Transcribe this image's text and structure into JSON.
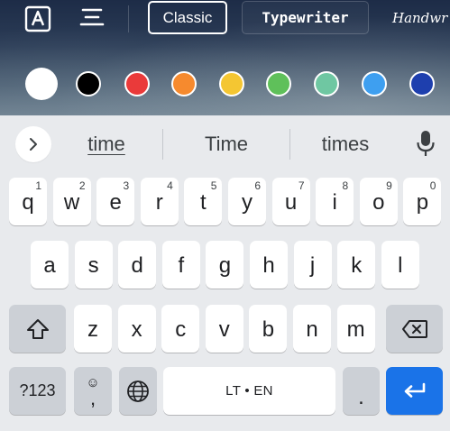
{
  "editor": {
    "fonts": [
      {
        "label": "Classic",
        "selected": true
      },
      {
        "label": "Typewriter",
        "selected": false
      },
      {
        "label": "Handwr",
        "selected": false
      }
    ],
    "icons": {
      "text_style": "text-box-icon",
      "align": "align-center-icon"
    },
    "colors": [
      {
        "hex": "#ffffff",
        "selected": true
      },
      {
        "hex": "#000000",
        "selected": false
      },
      {
        "hex": "#ea3a3a",
        "selected": false
      },
      {
        "hex": "#f68a2e",
        "selected": false
      },
      {
        "hex": "#f4c632",
        "selected": false
      },
      {
        "hex": "#5fc05a",
        "selected": false
      },
      {
        "hex": "#6fc7a2",
        "selected": false
      },
      {
        "hex": "#3e9ff0",
        "selected": false
      },
      {
        "hex": "#1e3fae",
        "selected": false
      }
    ]
  },
  "keyboard": {
    "suggestions": [
      "time",
      "Time",
      "times"
    ],
    "row1": [
      {
        "letter": "q",
        "hint": "1"
      },
      {
        "letter": "w",
        "hint": "2"
      },
      {
        "letter": "e",
        "hint": "3"
      },
      {
        "letter": "r",
        "hint": "4"
      },
      {
        "letter": "t",
        "hint": "5"
      },
      {
        "letter": "y",
        "hint": "6"
      },
      {
        "letter": "u",
        "hint": "7"
      },
      {
        "letter": "i",
        "hint": "8"
      },
      {
        "letter": "o",
        "hint": "9"
      },
      {
        "letter": "p",
        "hint": "0"
      }
    ],
    "row2": [
      "a",
      "s",
      "d",
      "f",
      "g",
      "h",
      "j",
      "k",
      "l"
    ],
    "row3": [
      "z",
      "x",
      "c",
      "v",
      "b",
      "n",
      "m"
    ],
    "bottom": {
      "symbols_label": "?123",
      "emoji_smiley": "☺",
      "emoji_comma": ",",
      "space_label": "LT • EN",
      "period_label": "."
    },
    "accent": "#1a73e8"
  }
}
